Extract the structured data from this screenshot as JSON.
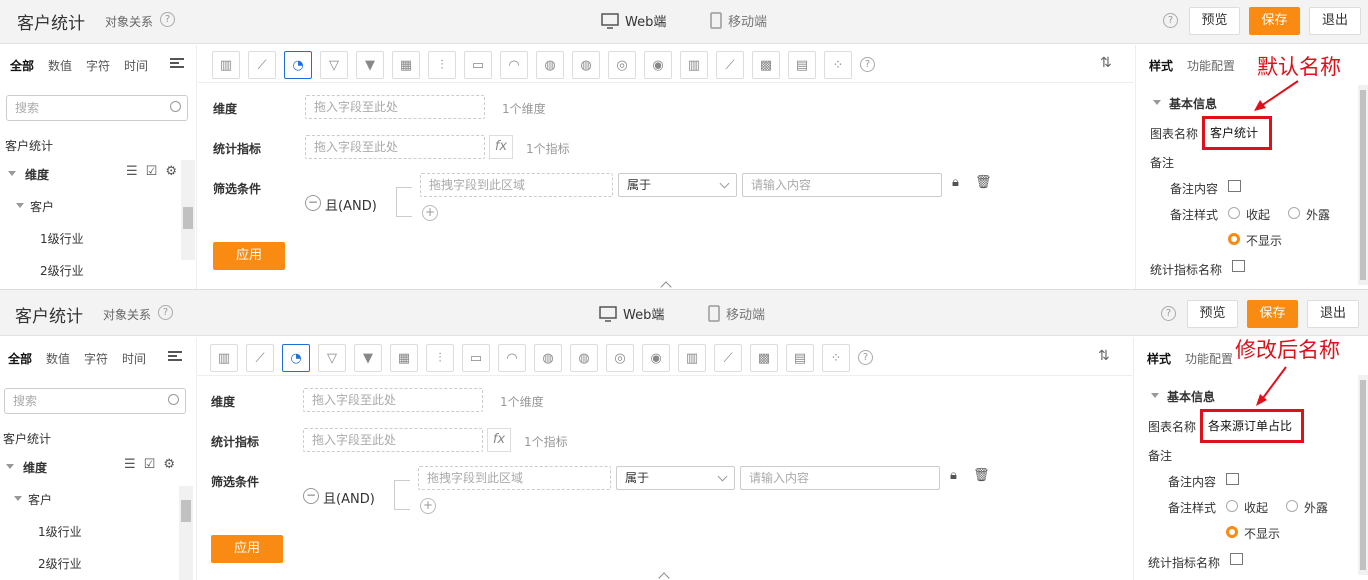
{
  "top": {
    "header": {
      "title": "客户统计",
      "obj_rel": "对象关系",
      "platform_web": "Web端",
      "platform_mobile": "移动端",
      "preview": "预览",
      "save": "保存",
      "exit": "退出"
    },
    "left": {
      "tabs": [
        "全部",
        "数值",
        "字符",
        "时间"
      ],
      "search_placeholder": "搜索",
      "source": "客户统计",
      "dimension": "维度",
      "customer": "客户",
      "industry1": "1级行业",
      "industry2": "2级行业"
    },
    "center": {
      "dimension_label": "维度",
      "dimension_drop": "拖入字段至此处",
      "dimension_hint": "1个维度",
      "metric_label": "统计指标",
      "metric_drop": "拖入字段至此处",
      "metric_hint": "1个指标",
      "filter_label": "筛选条件",
      "and_label": "且(AND)",
      "filter_drop": "拖拽字段到此区域",
      "filter_op": "属于",
      "filter_input": "请输入内容",
      "apply": "应用"
    },
    "right": {
      "tab_style": "样式",
      "tab_func": "功能配置",
      "basic_info": "基本信息",
      "chart_name_label": "图表名称",
      "chart_name_value": "客户统计",
      "remark": "备注",
      "remark_content": "备注内容",
      "remark_style": "备注样式",
      "opt_collapse": "收起",
      "opt_external": "外露",
      "opt_hide": "不显示",
      "metric_name": "统计指标名称"
    },
    "annotation": "默认名称"
  },
  "bottom": {
    "header": {
      "title": "客户统计",
      "obj_rel": "对象关系",
      "platform_web": "Web端",
      "platform_mobile": "移动端",
      "preview": "预览",
      "save": "保存",
      "exit": "退出"
    },
    "left": {
      "tabs": [
        "全部",
        "数值",
        "字符",
        "时间"
      ],
      "search_placeholder": "搜索",
      "source": "客户统计",
      "dimension": "维度",
      "customer": "客户",
      "industry1": "1级行业",
      "industry2": "2级行业"
    },
    "center": {
      "dimension_label": "维度",
      "dimension_drop": "拖入字段至此处",
      "dimension_hint": "1个维度",
      "metric_label": "统计指标",
      "metric_drop": "拖入字段至此处",
      "metric_hint": "1个指标",
      "filter_label": "筛选条件",
      "and_label": "且(AND)",
      "filter_drop": "拖拽字段到此区域",
      "filter_op": "属于",
      "filter_input": "请输入内容",
      "apply": "应用"
    },
    "right": {
      "tab_style": "样式",
      "tab_func": "功能配置",
      "basic_info": "基本信息",
      "chart_name_label": "图表名称",
      "chart_name_value": "各来源订单占比",
      "remark": "备注",
      "remark_content": "备注内容",
      "remark_style": "备注样式",
      "opt_collapse": "收起",
      "opt_external": "外露",
      "opt_hide": "不显示",
      "metric_name": "统计指标名称"
    },
    "annotation": "修改后名称"
  },
  "colors": {
    "accent": "#f98b13",
    "annotation_red": "#e0101a",
    "active_icon": "#1e6fd9"
  },
  "chart_type_icons": [
    "bar-chart-icon",
    "line-chart-icon",
    "pie-chart-icon",
    "funnel-icon",
    "funnel-alt-icon",
    "table-icon",
    "combo-chart-icon",
    "card-icon",
    "gauge-icon",
    "china-map-icon",
    "china-map-alt-icon",
    "world-map-icon",
    "world-map-alt-icon",
    "column-icon",
    "area-icon",
    "heatmap-icon",
    "list-icon",
    "scatter-icon"
  ]
}
